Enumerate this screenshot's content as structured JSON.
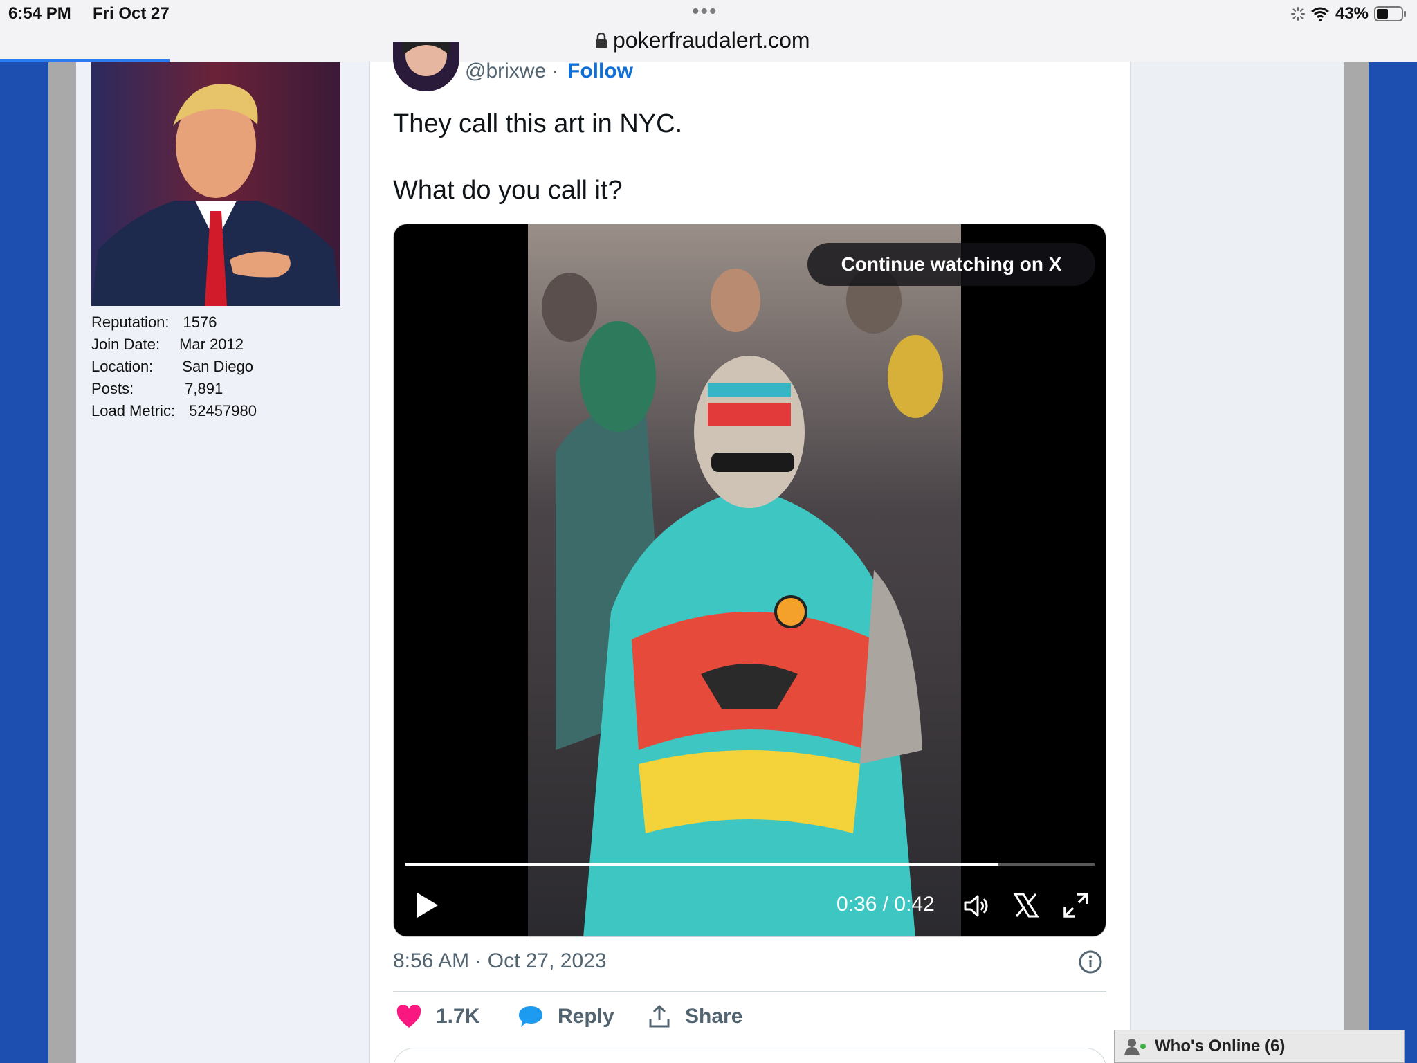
{
  "status_bar": {
    "time": "6:54 PM",
    "date": "Fri Oct 27",
    "battery": "43%"
  },
  "url_bar": {
    "domain": "pokerfraudalert.com"
  },
  "user_profile": {
    "fields": [
      {
        "label": "Reputation:",
        "value": "1576",
        "gap": "20px"
      },
      {
        "label": "Join Date:",
        "value": "Mar 2012",
        "gap": "28px"
      },
      {
        "label": "Location:",
        "value": "San Diego",
        "gap": "42px"
      },
      {
        "label": "Posts:",
        "value": "7,891",
        "gap": "74px"
      },
      {
        "label": "Load Metric:",
        "value": "52457980",
        "gap": "20px"
      }
    ]
  },
  "tweet": {
    "handle": "@brixwe ·",
    "follow_label": "Follow",
    "text_line1": "They call this art in NYC.",
    "text_line2": "What do you call it?",
    "timestamp": "8:56 AM · Oct 27, 2023",
    "video": {
      "continue_label": "Continue watching on X",
      "time_display": "0:36 / 0:42",
      "progress": 0.86
    },
    "actions": {
      "likes": "1.7K",
      "reply_label": "Reply",
      "share_label": "Share"
    }
  },
  "whos_online": {
    "label": "Who's Online (6)"
  },
  "colors": {
    "page_blue": "#1c4fb0",
    "link_blue": "#0f6fd8",
    "like_pink": "#f91880",
    "reply_blue": "#1d9bf0"
  }
}
